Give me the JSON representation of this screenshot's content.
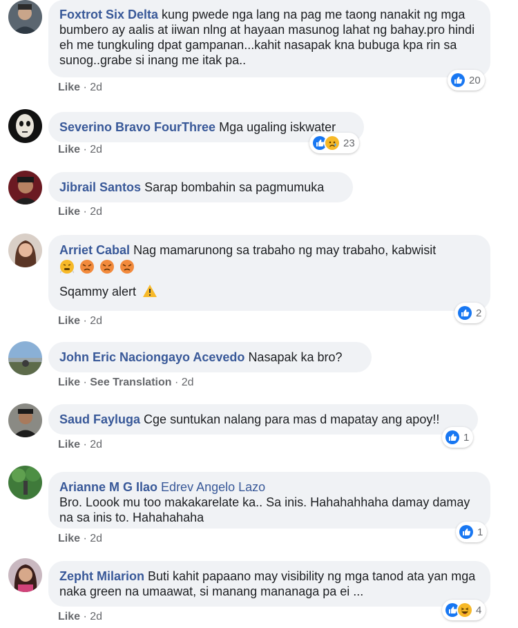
{
  "colors": {
    "author": "#385898",
    "bubble": "#f0f2f5",
    "meta": "#65676b",
    "like_blue": "#1877f2",
    "haha_yellow": "#f7b928"
  },
  "actions": {
    "like": "Like",
    "see_translation": "See Translation",
    "sep": "·"
  },
  "comments": [
    {
      "author": "Foxtrot Six Delta",
      "text": "kung pwede nga lang na pag me taong nanakit ng mga bumbero ay aalis at iiwan nlng at hayaan masunog lahat ng bahay.pro hindi eh me tungkuling dpat gampanan...kahit nasapak kna bubuga kpa rin sa sunog..grabe si inang me itak pa..",
      "time": "2d",
      "reactions": [
        "like-icon"
      ],
      "count": "20"
    },
    {
      "author": "Severino Bravo FourThree",
      "text": "Mga ugaling iskwater",
      "time": "2d",
      "reactions": [
        "like-icon",
        "sad-icon"
      ],
      "count": "23"
    },
    {
      "author": "Jibrail Santos",
      "text": "Sarap bombahin sa pagmumuka",
      "time": "2d"
    },
    {
      "author": "Arriet Cabal",
      "text": "Nag mamarunong sa trabaho ng may trabaho, kabwisit",
      "emojis": [
        "huffing-face-emoji",
        "angry-face-emoji",
        "angry-face-emoji",
        "angry-face-emoji"
      ],
      "text2": "Sqammy alert",
      "time": "2d",
      "reactions": [
        "like-icon"
      ],
      "count": "2"
    },
    {
      "author": "John Eric Naciongayo Acevedo",
      "text": "Nasapak ka bro?",
      "time": "2d",
      "translate": true
    },
    {
      "author": "Saud Fayluga",
      "text": "Cge suntukan nalang para mas d mapatay ang apoy!!",
      "time": "2d",
      "reactions": [
        "like-icon"
      ],
      "count": "1"
    },
    {
      "author": "Arianne M G Ilao",
      "tag": "Edrev Angelo Lazo",
      "text": "Bro. Loook mu too makakarelate ka.. Sa inis. Hahahahhaha damay damay na sa inis to. Hahahahaha",
      "time": "2d",
      "reactions": [
        "like-icon"
      ],
      "count": "1"
    },
    {
      "author": "Zepht Milarion",
      "text": "Buti kahit papaano may visibility ng mga tanod ata yan mga naka green na umaawat, si manang mananaga pa ei ...",
      "time": "2d",
      "reactions": [
        "like-icon",
        "haha-icon"
      ],
      "count": "4"
    }
  ]
}
